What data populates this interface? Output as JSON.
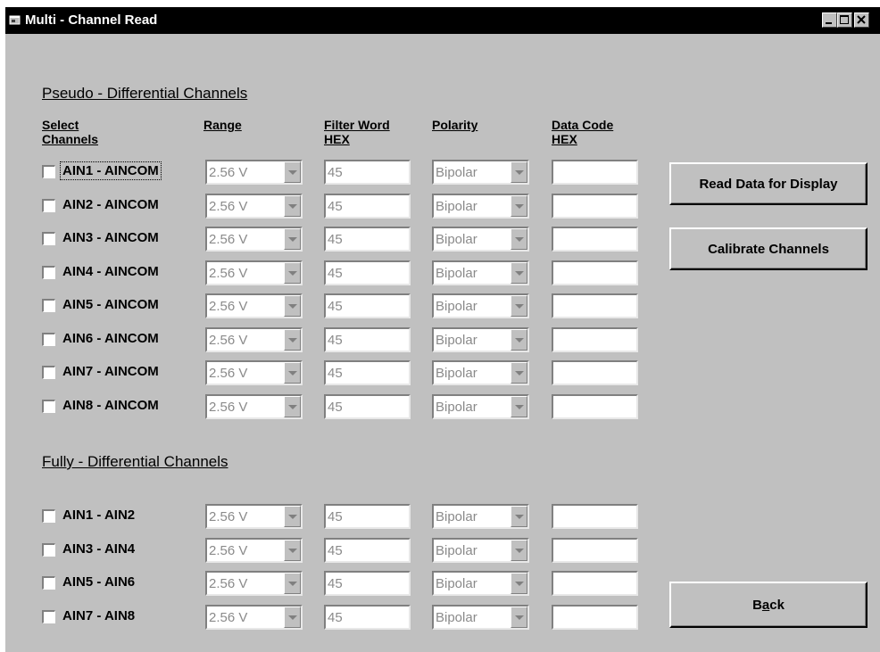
{
  "window": {
    "title": "Multi - Channel Read"
  },
  "pseudo": {
    "section_title": "Pseudo - Differential Channels",
    "headers": {
      "select_1": "Select",
      "select_2": "Channels",
      "range": "Range",
      "filter_1": "Filter Word",
      "filter_2": "HEX",
      "polarity": "Polarity",
      "data_1": "Data Code",
      "data_2": "HEX"
    },
    "rows": [
      {
        "label": "AIN1 - AINCOM",
        "range": "2.56 V",
        "filter": "45",
        "polarity": "Bipolar",
        "data": ""
      },
      {
        "label": "AIN2 - AINCOM",
        "range": "2.56 V",
        "filter": "45",
        "polarity": "Bipolar",
        "data": ""
      },
      {
        "label": "AIN3 - AINCOM",
        "range": "2.56 V",
        "filter": "45",
        "polarity": "Bipolar",
        "data": ""
      },
      {
        "label": "AIN4 - AINCOM",
        "range": "2.56 V",
        "filter": "45",
        "polarity": "Bipolar",
        "data": ""
      },
      {
        "label": "AIN5 - AINCOM",
        "range": "2.56 V",
        "filter": "45",
        "polarity": "Bipolar",
        "data": ""
      },
      {
        "label": "AIN6 - AINCOM",
        "range": "2.56 V",
        "filter": "45",
        "polarity": "Bipolar",
        "data": ""
      },
      {
        "label": "AIN7 - AINCOM",
        "range": "2.56 V",
        "filter": "45",
        "polarity": "Bipolar",
        "data": ""
      },
      {
        "label": "AIN8 - AINCOM",
        "range": "2.56 V",
        "filter": "45",
        "polarity": "Bipolar",
        "data": ""
      }
    ]
  },
  "fully": {
    "section_title": "Fully - Differential Channels",
    "rows": [
      {
        "label": "AIN1 - AIN2",
        "range": "2.56 V",
        "filter": "45",
        "polarity": "Bipolar",
        "data": ""
      },
      {
        "label": "AIN3 - AIN4",
        "range": "2.56 V",
        "filter": "45",
        "polarity": "Bipolar",
        "data": ""
      },
      {
        "label": "AIN5 - AIN6",
        "range": "2.56 V",
        "filter": "45",
        "polarity": "Bipolar",
        "data": ""
      },
      {
        "label": "AIN7 - AIN8",
        "range": "2.56 V",
        "filter": "45",
        "polarity": "Bipolar",
        "data": ""
      }
    ]
  },
  "buttons": {
    "read": "Read Data for Display",
    "calibrate": "Calibrate Channels",
    "back_pre": "B",
    "back_accel": "a",
    "back_post": "ck"
  },
  "colors": {
    "titlebar": "#000000",
    "face": "#c0c0c0",
    "disabled_text": "#8a8a8a"
  },
  "icons": {
    "app": "window-app-icon",
    "minimize": "minimize-icon",
    "maximize": "maximize-icon",
    "close": "close-icon",
    "dropdown": "chevron-down-icon"
  }
}
